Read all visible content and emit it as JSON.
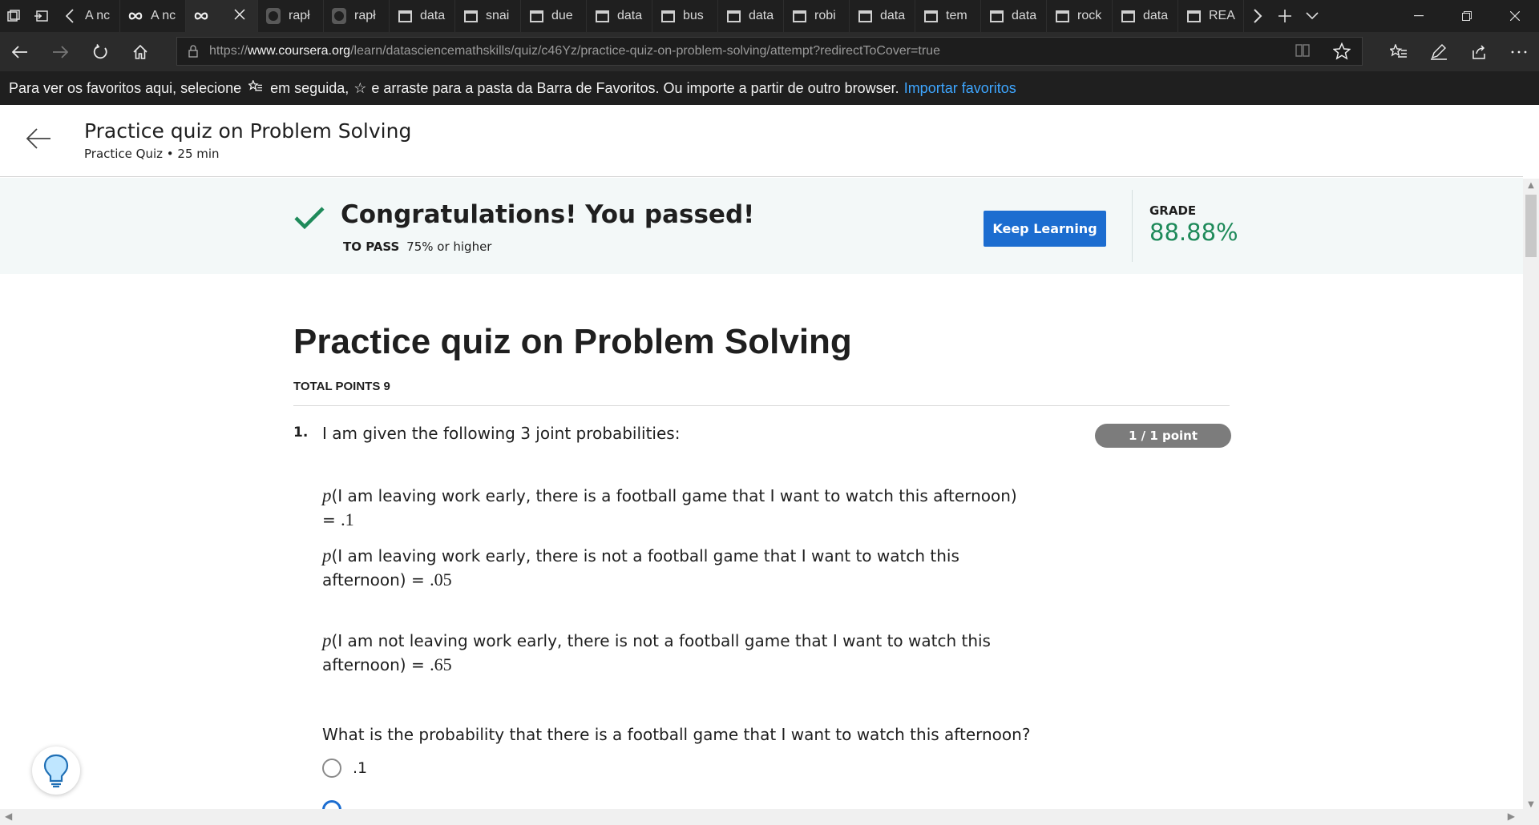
{
  "browser": {
    "tabs": [
      {
        "label": "A nc",
        "icon": "back-arrow-icon"
      },
      {
        "label": "A nc",
        "icon": "infinity-icon"
      },
      {
        "label": "",
        "icon": "infinity-icon",
        "active": true
      },
      {
        "label": "rapł",
        "icon": "github-icon"
      },
      {
        "label": "rapł",
        "icon": "github-icon"
      },
      {
        "label": "data",
        "icon": "page-icon"
      },
      {
        "label": "snai",
        "icon": "page-icon"
      },
      {
        "label": "due",
        "icon": "page-icon"
      },
      {
        "label": "data",
        "icon": "page-icon"
      },
      {
        "label": "bus",
        "icon": "page-icon"
      },
      {
        "label": "data",
        "icon": "page-icon"
      },
      {
        "label": "robi",
        "icon": "page-icon"
      },
      {
        "label": "data",
        "icon": "page-icon"
      },
      {
        "label": "tem",
        "icon": "page-icon"
      },
      {
        "label": "data",
        "icon": "page-icon"
      },
      {
        "label": "rock",
        "icon": "page-icon"
      },
      {
        "label": "data",
        "icon": "page-icon"
      },
      {
        "label": "REA",
        "icon": "page-icon"
      }
    ],
    "url": {
      "scheme": "https://",
      "host": "www.coursera.org",
      "path": "/learn/datasciencemathskills/quiz/c46Yz/practice-quiz-on-problem-solving/attempt?redirectToCover=true"
    },
    "favorites_bar": {
      "text1": "Para ver os favoritos aqui, selecione",
      "text2": "em seguida,",
      "text3": "e arraste para a pasta da Barra de Favoritos. Ou importe a partir de outro browser.",
      "link": "Importar favoritos"
    }
  },
  "header": {
    "title": "Practice quiz on Problem Solving",
    "subtitle": "Practice Quiz • 25 min"
  },
  "result": {
    "title": "Congratulations! You passed!",
    "to_pass_label": "TO PASS",
    "to_pass_value": "75% or higher",
    "button": "Keep Learning",
    "grade_label": "GRADE",
    "grade_value": "88.88%",
    "accent_color": "#1e8a5a"
  },
  "quiz": {
    "title": "Practice quiz on Problem Solving",
    "total_points": "TOTAL POINTS 9",
    "question": {
      "number": "1.",
      "text": "I am given the following 3 joint probabilities:",
      "points": "1 / 1 point",
      "probabilities": [
        {
          "var": "p",
          "text": "(I am leaving work early, there is a football game that I want to watch this afternoon) =",
          "value": ".1"
        },
        {
          "var": "p",
          "text": "(I am leaving work early, there is not a football game that I want to watch this afternoon) =",
          "value": ".05"
        },
        {
          "var": "p",
          "text": "(I am not leaving work early, there is not a football game that I want to watch this afternoon) =",
          "value": ".65"
        }
      ],
      "prompt": "What is the probability that there is a football game that I want to watch this afternoon?",
      "options": [
        ".1"
      ]
    }
  }
}
